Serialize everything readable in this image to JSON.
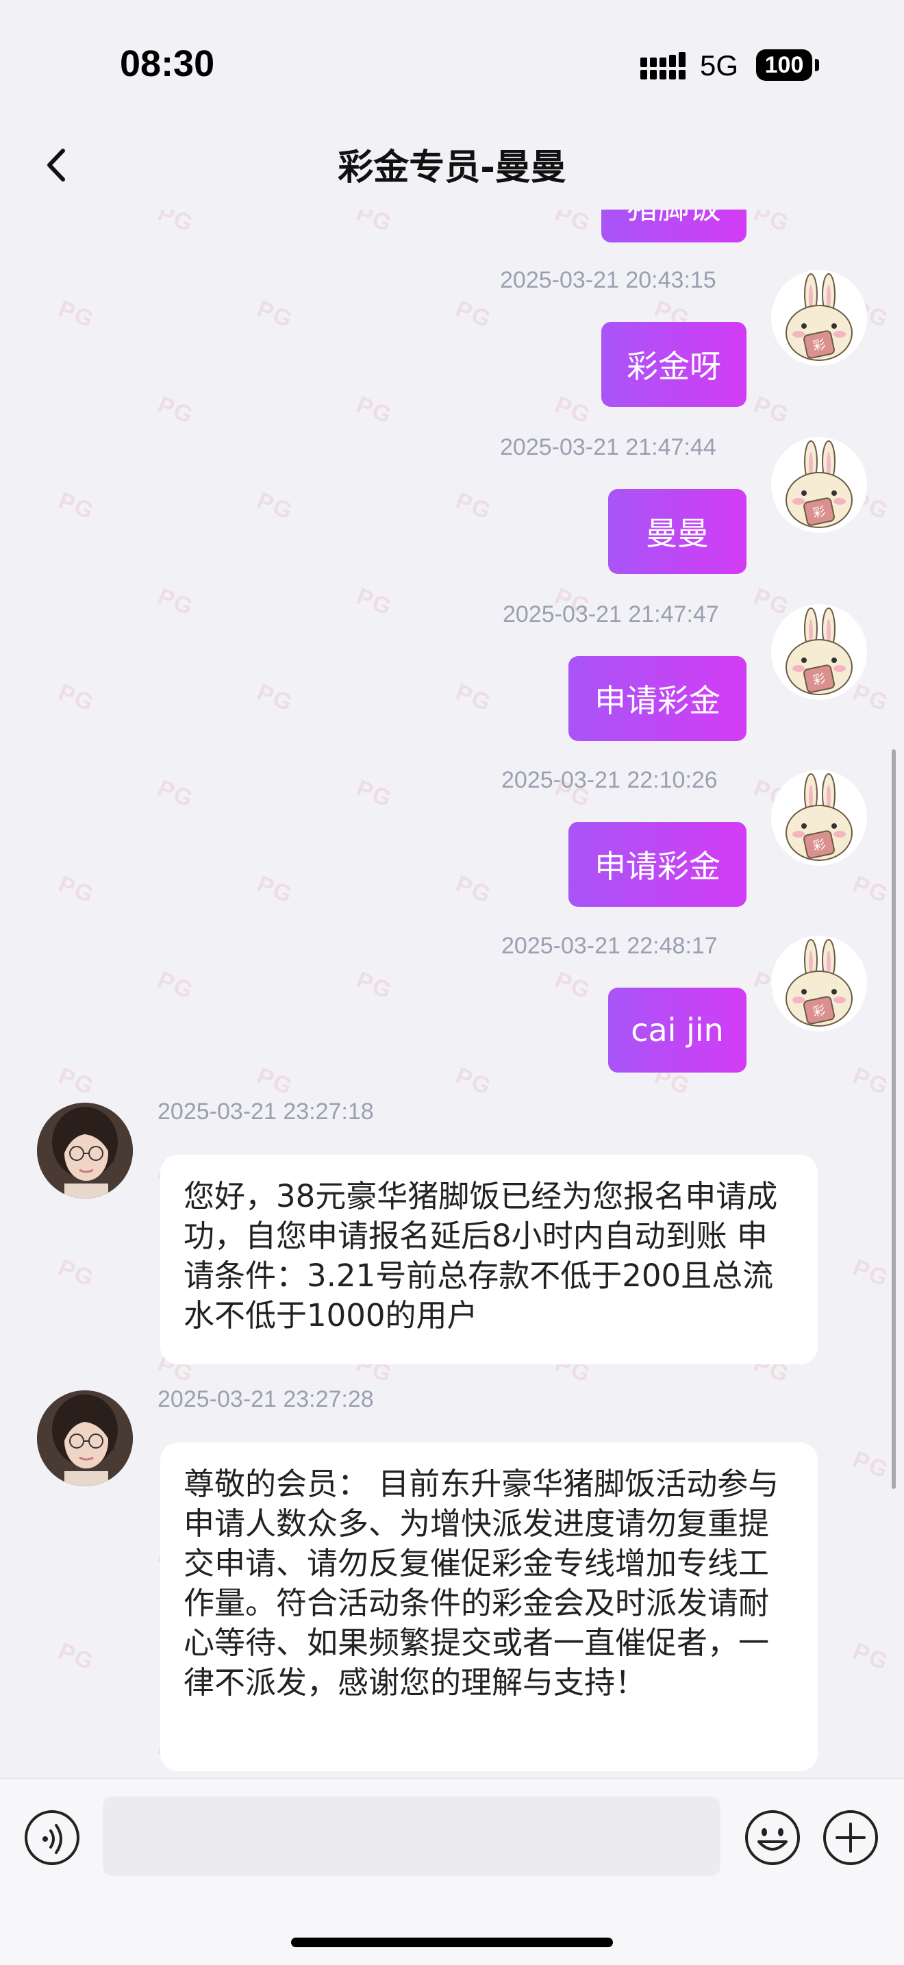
{
  "status_bar": {
    "time": "08:30",
    "network": "5G",
    "battery": "100"
  },
  "nav": {
    "title": "彩金专员-曼曼"
  },
  "partial_bubble": "猪脚饭",
  "messages_out": [
    {
      "timestamp": "2025-03-21 20:43:15",
      "text": "彩金呀"
    },
    {
      "timestamp": "2025-03-21 21:47:44",
      "text": "曼曼"
    },
    {
      "timestamp": "2025-03-21 21:47:47",
      "text": "申请彩金"
    },
    {
      "timestamp": "2025-03-21 22:10:26",
      "text": "申请彩金"
    },
    {
      "timestamp": "2025-03-21 22:48:17",
      "text": "cai jin"
    }
  ],
  "messages_in": [
    {
      "timestamp": "2025-03-21 23:27:18",
      "text": "您好，38元豪华猪脚饭已经为您报名申请成功，自您申请报名延后8小时内自动到账 申请条件：3.21号前总存款不低于200且总流水不低于1000的用户"
    },
    {
      "timestamp": "2025-03-21 23:27:28",
      "text": "尊敬的会员： 目前东升豪华猪脚饭活动参与申请人数众多、为增快派发进度请勿复重提交申请、请勿反复催促彩金专线增加专线工作量。符合活动条件的彩金会及时派发请耐心等待、如果频繁提交或者一直催促者，一律不派发，感谢您的理解与支持！"
    }
  ],
  "watermark": "PG",
  "input": {
    "placeholder": ""
  },
  "icons": {
    "voice": "voice-icon",
    "emoji": "emoji-icon",
    "plus": "plus-icon",
    "back": "back-icon"
  }
}
